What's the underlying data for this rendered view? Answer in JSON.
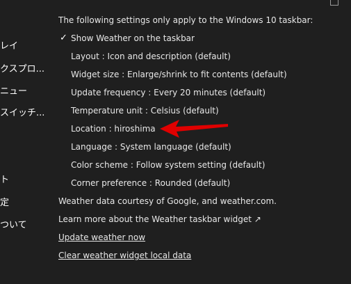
{
  "sidebar": {
    "items": [
      {
        "label": "レイ"
      },
      {
        "label": "クスプロ..."
      },
      {
        "label": "ニュー"
      },
      {
        "label": "スイッチ..."
      },
      {
        "label": "ト"
      },
      {
        "label": "定"
      },
      {
        "label": "ついて"
      }
    ]
  },
  "panel": {
    "intro": "The following settings only apply to the Windows 10 taskbar:",
    "show_weather": "Show Weather on the taskbar",
    "show_weather_checked": true,
    "settings": [
      {
        "label": "Layout : Icon and description (default)"
      },
      {
        "label": "Widget size : Enlarge/shrink to fit contents (default)"
      },
      {
        "label": "Update frequency : Every 20 minutes (default)"
      },
      {
        "label": "Temperature unit : Celsius (default)"
      },
      {
        "label": "Location : hiroshima"
      },
      {
        "label": "Language : System language (default)"
      },
      {
        "label": "Color scheme : Follow system setting (default)"
      },
      {
        "label": "Corner preference : Rounded (default)"
      }
    ],
    "courtesy": "Weather data courtesy of Google, and weather.com.",
    "learn_more": "Learn more about the Weather taskbar widget ↗",
    "update_now": "Update weather now",
    "clear_data": "Clear weather widget local data"
  },
  "annotation": {
    "arrow_color": "#e00000"
  }
}
